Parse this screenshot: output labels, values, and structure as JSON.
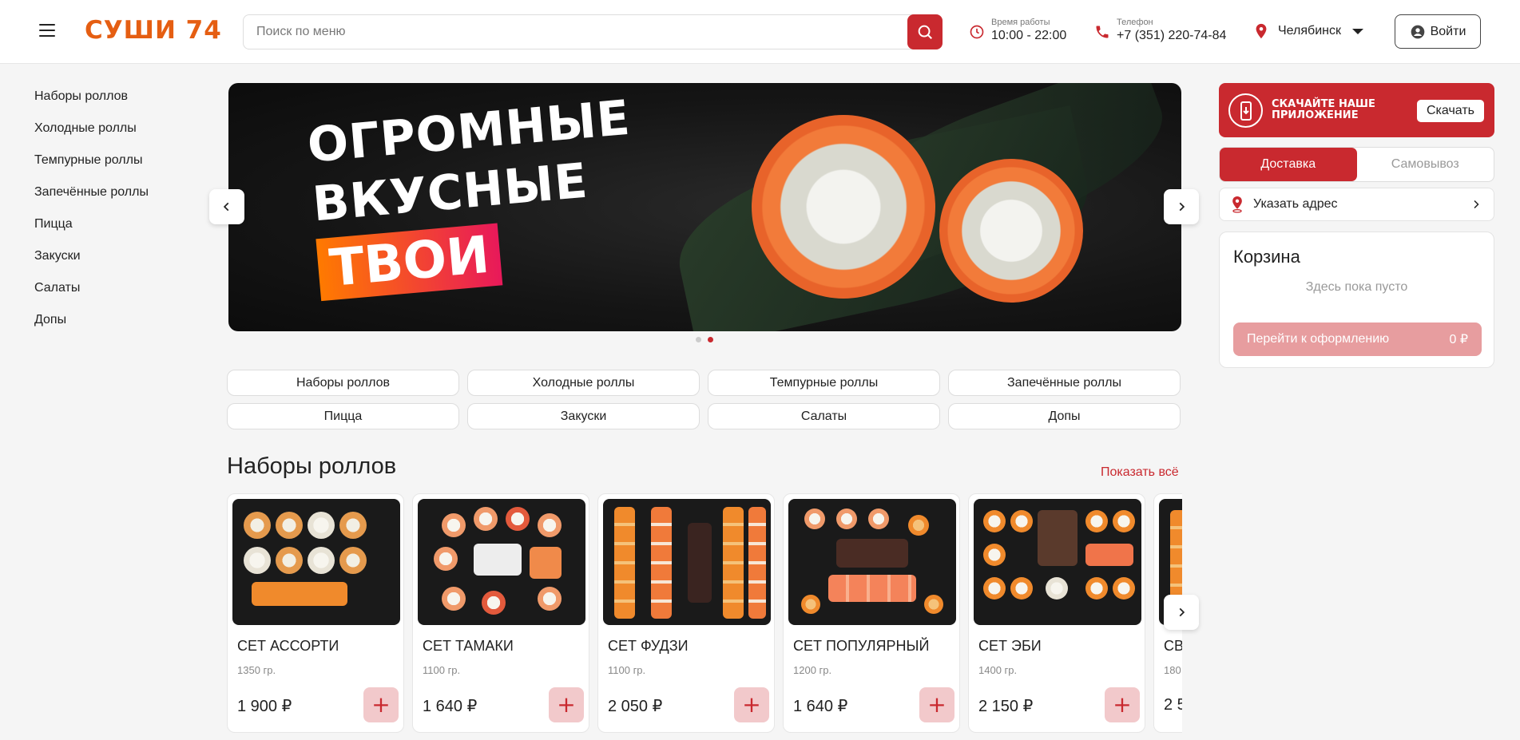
{
  "header": {
    "logo": "СУШИ 74",
    "search_placeholder": "Поиск по меню",
    "hours_caption": "Время работы",
    "hours_value": "10:00 - 22:00",
    "phone_caption": "Телефон",
    "phone_value": "+7 (351) 220-74-84",
    "city": "Челябинск",
    "login_label": "Войти"
  },
  "sidebar": {
    "items": [
      {
        "label": "Наборы роллов"
      },
      {
        "label": "Холодные роллы"
      },
      {
        "label": "Темпурные роллы"
      },
      {
        "label": "Запечённые роллы"
      },
      {
        "label": "Пицца"
      },
      {
        "label": "Закуски"
      },
      {
        "label": "Салаты"
      },
      {
        "label": "Допы"
      }
    ]
  },
  "banner": {
    "line1": "ОГРОМНЫЕ",
    "line2": "ВКУСНЫЕ",
    "line3": "ТВОИ",
    "slides_total": 2,
    "active_slide": 2
  },
  "categories": [
    {
      "label": "Наборы роллов"
    },
    {
      "label": "Холодные роллы"
    },
    {
      "label": "Темпурные роллы"
    },
    {
      "label": "Запечённые роллы"
    },
    {
      "label": "Пицца"
    },
    {
      "label": "Закуски"
    },
    {
      "label": "Салаты"
    },
    {
      "label": "Допы"
    }
  ],
  "section": {
    "title": "Наборы роллов",
    "show_all": "Показать всё"
  },
  "products": [
    {
      "name": "СЕТ АССОРТИ",
      "weight": "1350 гр.",
      "price": "1 900 ₽"
    },
    {
      "name": "СЕТ ТАМАКИ",
      "weight": "1100 гр.",
      "price": "1 640 ₽"
    },
    {
      "name": "СЕТ ФУДЗИ",
      "weight": "1100 гр.",
      "price": "2 050 ₽"
    },
    {
      "name": "СЕТ ПОПУЛЯРНЫЙ",
      "weight": "1200 гр.",
      "price": "1 640 ₽"
    },
    {
      "name": "СЕТ ЭБИ",
      "weight": "1400 гр.",
      "price": "2 150 ₽"
    },
    {
      "name": "СВ",
      "weight": "180",
      "price": "2 5"
    }
  ],
  "add_label": "+",
  "app_banner": {
    "line1": "СКАЧАЙТЕ НАШЕ",
    "line2": "ПРИЛОЖЕНИЕ",
    "button": "Скачать"
  },
  "delivery_toggle": {
    "delivery": "Доставка",
    "pickup": "Самовывоз",
    "selected": "Доставка"
  },
  "address": {
    "label": "Указать адрес"
  },
  "cart": {
    "title": "Корзина",
    "empty_text": "Здесь пока пусто",
    "checkout_label": "Перейти к оформлению",
    "total": "0 ₽"
  },
  "colors": {
    "accent": "#c9292f",
    "logo": "#e55e12",
    "accent_light": "#f2c9cb"
  }
}
